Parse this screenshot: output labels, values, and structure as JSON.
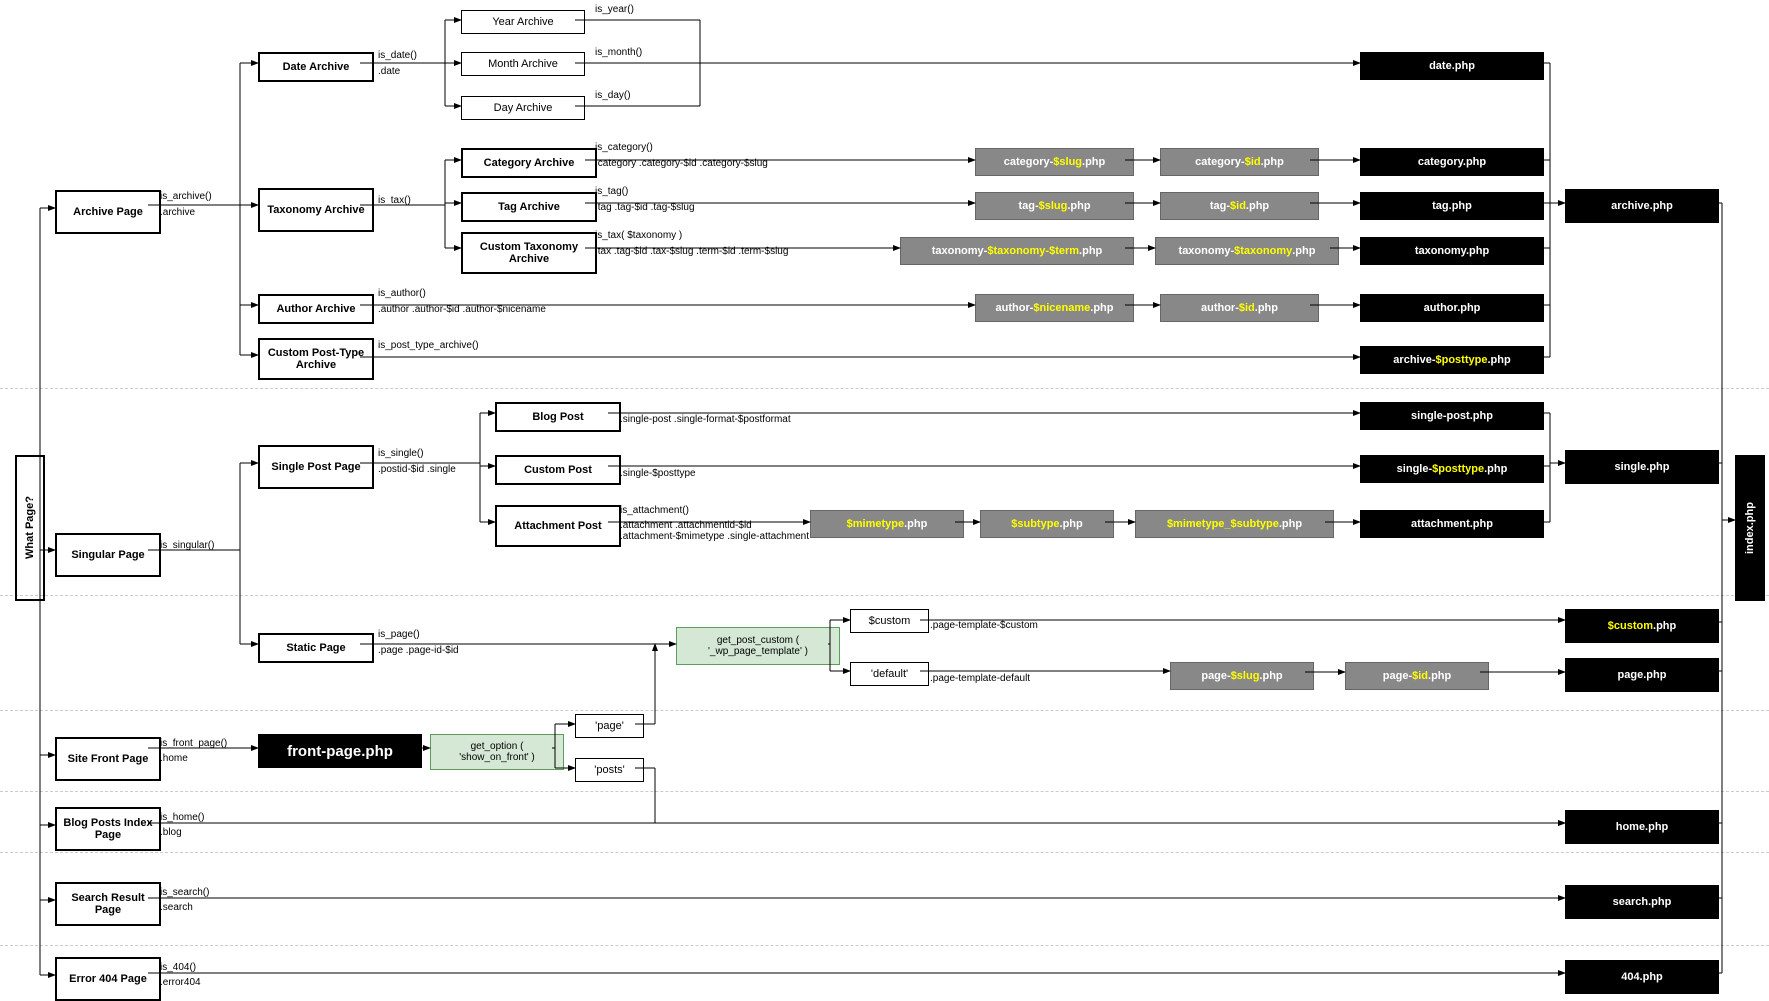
{
  "root": "What Page?",
  "final": "index.php",
  "pages": {
    "archive": {
      "t": "Archive Page",
      "cond": "is_archive()",
      "cls": ".archive"
    },
    "singular": {
      "t": "Singular Page",
      "cond": "is_singular()"
    },
    "front": {
      "t": "Site Front Page",
      "cond": "is_front_page()",
      "cls": ".home"
    },
    "blog": {
      "t": "Blog Posts Index Page",
      "cond": "is_home()",
      "cls": ".blog"
    },
    "search": {
      "t": "Search Result Page",
      "cond": "is_search()",
      "cls": ".search"
    },
    "err": {
      "t": "Error 404 Page",
      "cond": "is_404()",
      "cls": ".error404"
    }
  },
  "arch": {
    "date": {
      "t": "Date Archive",
      "cond": "is_date()",
      "cls": ".date",
      "sub": [
        {
          "t": "Year Archive",
          "c": "is_year()"
        },
        {
          "t": "Month Archive",
          "c": "is_month()"
        },
        {
          "t": "Day Archive",
          "c": "is_day()"
        }
      ],
      "tpl": "date.php"
    },
    "tax": {
      "t": "Taxonomy Archive",
      "cond": "is_tax()",
      "sub": [
        {
          "t": "Category Archive",
          "c": "is_category()",
          "cls": ".category .category-$id .category-$slug",
          "a": "category-",
          "b": "$slug",
          "d": ".php",
          "e": "category-",
          "f": "$id",
          "g": ".php",
          "tpl": "category.php"
        },
        {
          "t": "Tag Archive",
          "c": "is_tag()",
          "cls": ".tag .tag-$id .tag-$slug",
          "a": "tag-",
          "b": "$slug",
          "d": ".php",
          "e": "tag-",
          "f": "$id",
          "g": ".php",
          "tpl": "tag.php"
        },
        {
          "t": "Custom Taxonomy Archive",
          "c": "is_tax( $taxonomy )",
          "cls": ".tax .tag-$id .tax-$slug .term-$id .term-$slug",
          "a": "taxonomy-",
          "b": "$taxonomy-$term",
          "d": ".php",
          "e": "taxonomy-",
          "f": "$taxonomy",
          "g": ".php",
          "tpl": "taxonomy.php"
        }
      ],
      "out": "archive.php"
    },
    "auth": {
      "t": "Author Archive",
      "cond": "is_author()",
      "cls": ".author .author-$id .author-$nicename",
      "a": "author-",
      "b": "$nicename",
      "d": ".php",
      "e": "author-",
      "f": "$id",
      "g": ".php",
      "tpl": "author.php"
    },
    "cpt": {
      "t": "Custom Post-Type Archive",
      "cond": "is_post_type_archive()",
      "a": "archive-",
      "b": "$posttype",
      "d": ".php"
    }
  },
  "sing": {
    "single": {
      "t": "Single Post Page",
      "cond": "is_single()",
      "cls": ".postid-$id .single",
      "sub": [
        {
          "t": "Blog Post",
          "cls": ".single-post .single-format-$postformat",
          "tpl": "single-post.php"
        },
        {
          "t": "Custom Post",
          "cls": ".single-$posttype",
          "a": "single-",
          "b": "$posttype",
          "d": ".php"
        },
        {
          "t": "Attachment Post",
          "c": "is_attachment()",
          "cls": ".attachment .attachmentid-$id .attachment-$mimetype .single-attachment",
          "m1": "$mimetype",
          "m2": "$subtype",
          "m3": "$mimetype_$subtype",
          "tpl": "attachment.php"
        }
      ],
      "out": "single.php"
    },
    "static": {
      "t": "Static Page",
      "cond": "is_page()",
      "cls": ".page .page-id-$id",
      "opt": "get_post_custom ( '_wp_page_template' )",
      "c1": "$custom",
      "c1cls": ".page-template-$custom",
      "c1tpl": "$custom",
      "c1ext": ".php",
      "c2": "'default'",
      "c2cls": ".page-template-default",
      "a": "page-",
      "b": "$slug",
      "d": ".php",
      "e": "page-",
      "f": "$id",
      "g": ".php",
      "out": "page.php"
    }
  },
  "front": {
    "tpl": "front-page.php",
    "opt": "get_option ( 'show_on_front' )",
    "o1": "'page'",
    "o2": "'posts'"
  },
  "outs": {
    "home": "home.php",
    "search": "search.php",
    "err": "404.php"
  }
}
